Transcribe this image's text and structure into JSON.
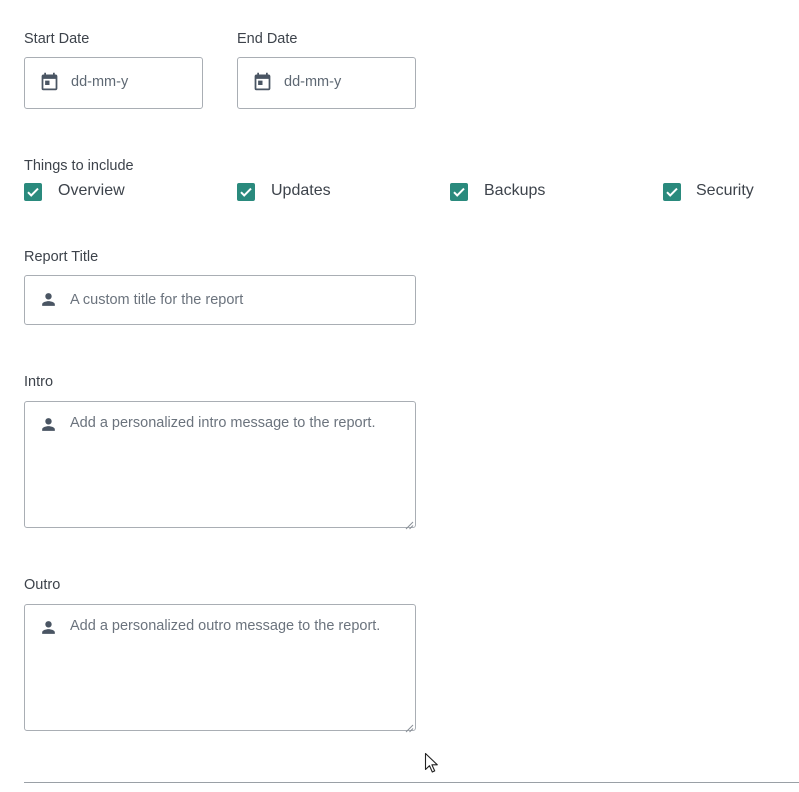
{
  "dates": {
    "start": {
      "label": "Start Date",
      "placeholder": "dd-mm-y",
      "icon": "calendar-icon"
    },
    "end": {
      "label": "End Date",
      "placeholder": "dd-mm-y",
      "icon": "calendar-icon"
    }
  },
  "include": {
    "label": "Things to include",
    "options": [
      {
        "label": "Overview",
        "checked": true
      },
      {
        "label": "Updates",
        "checked": true
      },
      {
        "label": "Backups",
        "checked": true
      },
      {
        "label": "Security",
        "checked": true
      }
    ]
  },
  "report_title": {
    "label": "Report Title",
    "placeholder": "A custom title for the report",
    "icon": "person-icon"
  },
  "intro": {
    "label": "Intro",
    "placeholder": "Add a personalized intro message to the report.",
    "icon": "person-icon"
  },
  "outro": {
    "label": "Outro",
    "placeholder": "Add a personalized outro message to the report.",
    "icon": "person-icon"
  },
  "colors": {
    "checkbox_accent": "#2a8a7d",
    "icon": "#4a5563",
    "border": "#a9aeb4"
  }
}
